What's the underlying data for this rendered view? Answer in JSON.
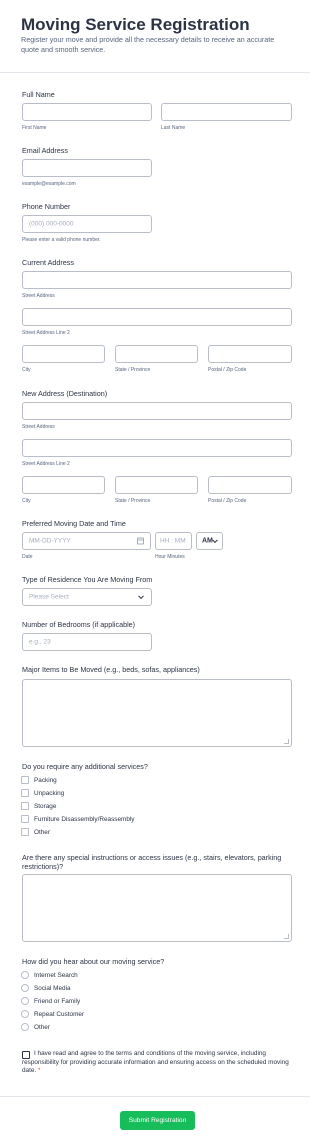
{
  "form": {
    "title": "Moving Service Registration",
    "description": "Register your move and provide all the necessary details to receive an accurate quote and smooth service.",
    "full_name": {
      "label": "Full Name",
      "first_sub": "First Name",
      "last_sub": "Last Name"
    },
    "email": {
      "label": "Email Address",
      "sub": "example@example.com"
    },
    "phone": {
      "label": "Phone Number",
      "placeholder": "(000) 000-0000",
      "sub": "Please enter a valid phone number."
    },
    "current_address": {
      "label": "Current Address",
      "street": "Street Address",
      "street2": "Street Address Line 2",
      "city": "City",
      "state": "State / Province",
      "zip": "Postal / Zip Code"
    },
    "new_address": {
      "label": "New Address (Destination)",
      "street": "Street Address",
      "street2": "Street Address Line 2",
      "city": "City",
      "state": "State / Province",
      "zip": "Postal / Zip Code"
    },
    "moving_date": {
      "label": "Preferred Moving Date and Time",
      "date_placeholder": "MM-DD-YYYY",
      "time_placeholder": "HH : MM",
      "ampm": "AM",
      "date_sub": "Date",
      "time_sub": "Hour Minutes"
    },
    "residence": {
      "label": "Type of Residence You Are Moving From",
      "placeholder": "Please Select"
    },
    "bedrooms": {
      "label": "Number of Bedrooms (if applicable)",
      "placeholder": "e.g., 23"
    },
    "items": {
      "label": "Major Items to Be Moved (e.g., beds, sofas, appliances)"
    },
    "services": {
      "label": "Do you require any additional services?",
      "options": [
        "Packing",
        "Unpacking",
        "Storage",
        "Furniture Disassembly/Reassembly",
        "Other"
      ]
    },
    "instructions": {
      "label": "Are there any special instructions or access issues (e.g., stairs, elevators, parking restrictions)?"
    },
    "referral": {
      "label": "How did you hear about our moving service?",
      "options": [
        "Internet Search",
        "Social Media",
        "Friend or Family",
        "Repeat Customer",
        "Other"
      ]
    },
    "terms": {
      "text": "I have read and agree to the terms and conditions of the moving service, including responsibility for providing accurate information and ensuring access on the scheduled moving date.",
      "required_mark": "*"
    },
    "submit_label": "Submit Registration"
  },
  "colors": {
    "submit": "#18bd5b",
    "text": "#2c3345",
    "subtext": "#57647e",
    "border": "#b8bdc9",
    "required": "#e5484d"
  }
}
